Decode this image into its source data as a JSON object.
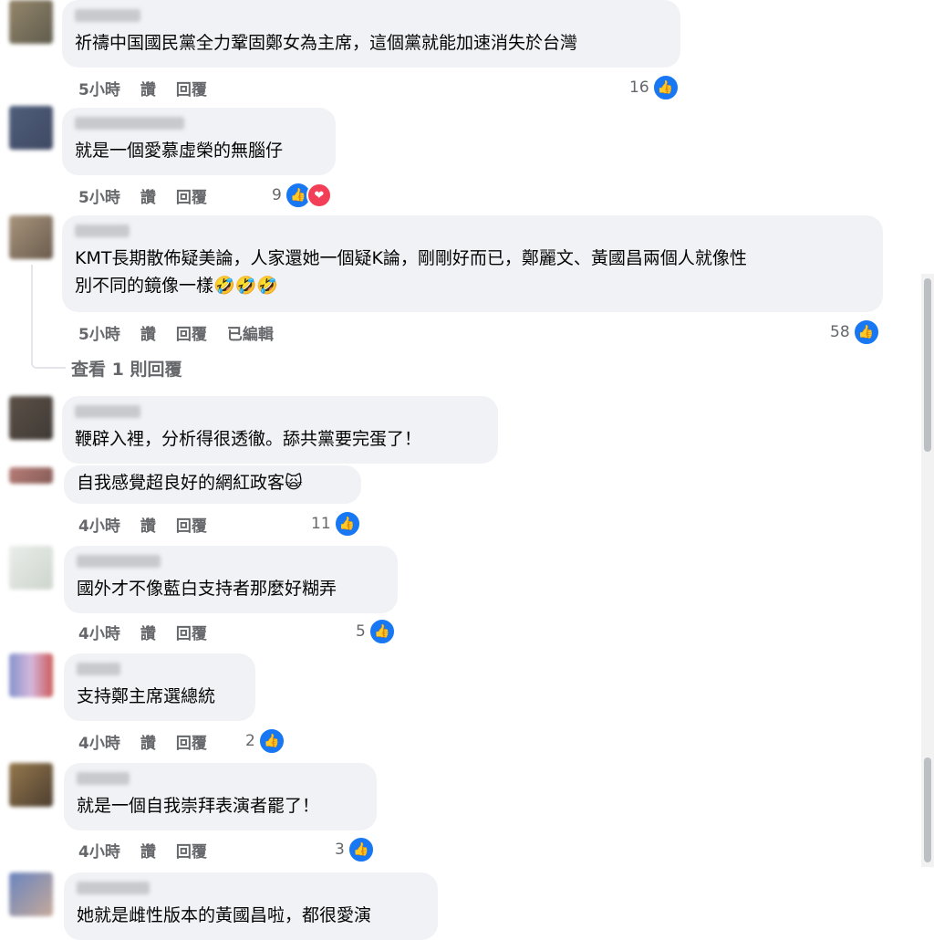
{
  "actions": {
    "like": "讚",
    "reply": "回覆",
    "edited": "已編輯"
  },
  "view_replies": "查看 1 則回覆",
  "comments": [
    {
      "text": "祈禱中国國民黨全力鞏固鄭女為主席，這個黨就能加速消失於台灣",
      "time": "5小時",
      "count": "16"
    },
    {
      "text": "就是一個愛慕虛榮的無腦仔",
      "time": "5小時",
      "count": "9"
    },
    {
      "text": "KMT長期散佈疑美論，人家還她一個疑K論，剛剛好而已，鄭麗文、黃國昌兩個人就像性\n別不同的鏡像一樣🤣🤣🤣",
      "time": "5小時",
      "count": "58"
    },
    {
      "text": "鞭辟入裡，分析得很透徹。舔共黨要完蛋了！"
    },
    {
      "text": "自我感覺超良好的網紅政客🙀",
      "time": "4小時",
      "count": "11"
    },
    {
      "text": "國外才不像藍白支持者那麼好糊弄",
      "time": "4小時",
      "count": "5"
    },
    {
      "text": "支持鄭主席選總統",
      "time": "4小時",
      "count": "2"
    },
    {
      "text": "就是一個自我崇拜表演者罷了！",
      "time": "4小時",
      "count": "3"
    },
    {
      "text": "她就是雌性版本的黃國昌啦，都很愛演"
    }
  ],
  "colors": {
    "like": "#1877f2",
    "love": "#f33e58",
    "bubble": "#f0f2f5",
    "meta": "#65676b"
  }
}
